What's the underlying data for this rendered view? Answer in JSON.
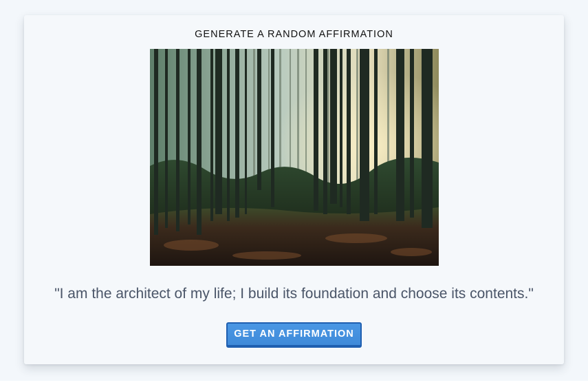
{
  "card": {
    "title": "GENERATE A RANDOM AFFIRMATION",
    "image": {
      "alt": "Sunlit pine forest",
      "icon": "forest-photo"
    },
    "affirmation": "\"I am the architect of my life; I build its foundation and choose its contents.\"",
    "button_label": "GET AN AFFIRMATION"
  },
  "colors": {
    "page_background": "#f3f7fb",
    "card_background": "#f5f8fb",
    "quote_text": "#4a5568",
    "button_fill": "#4390de",
    "button_border": "#1f5fb0"
  }
}
